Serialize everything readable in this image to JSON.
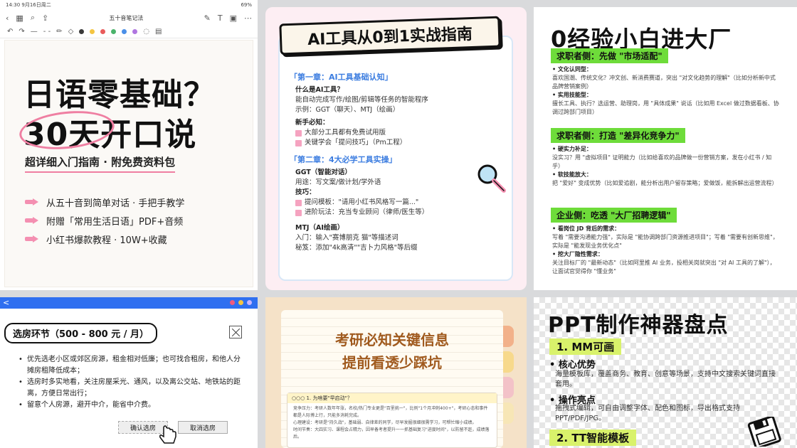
{
  "card1": {
    "status_left": "14:30 9月16日周二",
    "status_right": "69%",
    "note_title": "五十音笔记法",
    "title_line1": "日语零基础？",
    "title_line2_a": "30天",
    "title_line2_b": "开口说",
    "subtitle": "超详细入门指南 · 附免费资料包",
    "items": [
      "从五十音到简单对话 · 手把手教学",
      "附赠「常用生活日语」PDF+音频",
      "小红书爆款教程 · 10W+收藏"
    ],
    "colors": {
      "accent": "#ef7fa2"
    }
  },
  "card2": {
    "title": "AI工具从0到1实战指南",
    "ch1": "「第一章：AI工具基础认知」",
    "q1": "什么是AI工具？",
    "a1": "能自动完成写作/绘图/剪辑等任务的智能程序",
    "ex1": "示例：GGT（聊天）、MTJ（绘画）",
    "newbie": "新手必知：",
    "tip1": "大部分工具都有免费试用版",
    "tip2": "关键学会「提问技巧」（Pm工程）",
    "ch2": "「第二章：4大必学工具实操」",
    "ggt": "GGT（智能对话）",
    "ggt_use": "用途：写文案/做计划/学外语",
    "skill": "技巧：",
    "skill1": "提问模板：\"请用小红书风格写一篇...\"",
    "skill2": "进阶玩法：充当专业顾问（律师/医生等）",
    "mtj": "MTJ（AI绘画）",
    "mtj1": "入门：输入\"赛博朋克 猫\"等描述词",
    "mtj2": "秘笈：添加\"4k高清\"\"吉卜力风格\"等后缀"
  },
  "card3": {
    "title": "0经验小白进大厂",
    "sec1": "求职者侧：先做 \"市场适配\"",
    "s1a_h": "• 文化认同型：",
    "s1a": "喜欢国潮、传统文化？冲文创、新消费赛道，突出 \"对文化趋势的理解\"（比如分析新中式品牌营销案例）",
    "s1b_h": "• 实用技能型：",
    "s1b": "擅长工具、执行？选运营、助理岗，用 \"具体成果\" 说话（比如用 Excel 做过数据看板、协调过跨部门项目）",
    "sec2": "求职者侧：打造 \"差异化竞争力\"",
    "s2a_h": "• 硬实力补足：",
    "s2a": "没实习？用 \"虚拟项目\" 证明能力（比如给喜欢的品牌做一份营销方案，发在小红书 / 知乎）",
    "s2b_h": "• 软技能放大：",
    "s2b": "把 \"爱好\" 变成优势（比如爱追剧，能分析出用户留存策略；爱做饭，能拆解出运营流程）",
    "sec3": "企业侧：吃透 \"大厂招聘逻辑\"",
    "s3a_h": "• 看岗位 JD 背后的需求：",
    "s3a": "写着 \"需要沟通能力强\"，实际是 \"能协调跨部门资源推进项目\"；写着 \"需要有创新思维\"，实际是 \"能发现业务优化点\"",
    "s3b_h": "• 挖大厂隐性需求：",
    "s3b": "关注目标厂的 \"最新动态\"（比如阿里推 AI 业务，投相关岗就突出 \"对 AI 工具的了解\"），让面试官觉得你 \"懂业务\""
  },
  "card4": {
    "back": "<",
    "heading": "选房环节（500 - 800 元 / 月）",
    "items": [
      "优先选老小区或郊区房源，租金相对低廉；也可找合租房，和他人分摊房租降低成本；",
      "选房时多实地看，关注房屋采光、通风，以及离公交站、地铁站的距离，方便日常出行；",
      "留意个人房源，避开中介，能省中介费。"
    ],
    "confirm": "确认选房",
    "cancel": "取消选房"
  },
  "card5": {
    "title1": "考研必知关键信息",
    "title2": "提前看透少踩坑",
    "box_head": "○○○  1. 为啥要\"早启动\"？",
    "box_l1": "竞争压力：考研人数年年涨，名校/热门专业更是\"百里挑一\"，比例\"1个月冲刺400+\"，考研心态和事件都是人际博上行，只能多消耗完成。",
    "box_l2": "心理建设：考研是\"持久战\"，基础弱、自律差的同学，尽早发掘很细很需学习，可帮忙缩小成绩。",
    "box_l3": "时间节奏：大四实习、课程会占精力，因早备考者提升一一抓基础复习\"进度时间\"，以防留不赶，成绩落后。"
  },
  "card6": {
    "title": "PPT制作神器盘点",
    "sec1": "1. MM可画",
    "h1": "• 核心优势",
    "t1": "海量模板库，覆盖商务、教育、创意等场景，支持中文搜索关键词直接套用。",
    "h2": "• 操作亮点",
    "t2": "拖拽式编辑，可自由调整字体、配色和图标，导出格式支持PPT/PDF/JPG。",
    "sec2": "2. TT智能模板"
  }
}
